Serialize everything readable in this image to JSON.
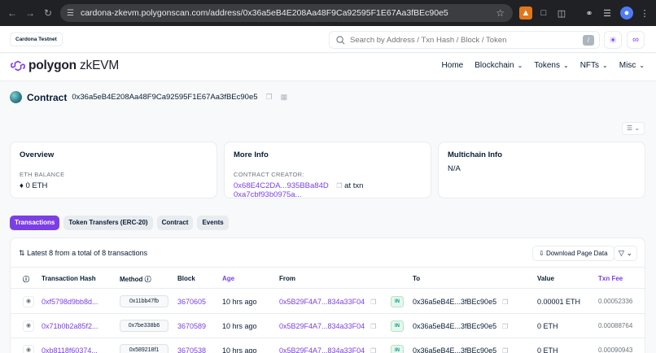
{
  "browser": {
    "url": "cardona-zkevm.polygonscan.com/address/0x36a5eB4E208Aa48F9Ca92595F1E67Aa3fBEc90e5"
  },
  "topbar": {
    "network_badge": "Cardona Testnet",
    "search_placeholder": "Search by Address / Txn Hash / Block / Token",
    "search_shortcut": "/"
  },
  "header": {
    "logo_bold": "polygon",
    "logo_light": " zkEVM",
    "menu": [
      {
        "label": "Home",
        "dropdown": false
      },
      {
        "label": "Blockchain",
        "dropdown": true
      },
      {
        "label": "Tokens",
        "dropdown": true
      },
      {
        "label": "NFTs",
        "dropdown": true
      },
      {
        "label": "Misc",
        "dropdown": true
      }
    ]
  },
  "contract": {
    "label": "Contract",
    "address": "0x36a5eB4E208Aa48F9Ca92595F1E67Aa3fBEc90e5"
  },
  "cards": {
    "overview": {
      "title": "Overview",
      "balance_label": "ETH BALANCE",
      "balance_value": "0 ETH"
    },
    "more_info": {
      "title": "More Info",
      "creator_label": "CONTRACT CREATOR:",
      "creator_addr": "0x68E4C2DA...935BBa84D",
      "at_txn": "at txn",
      "txn_hash": "0xa7cbf93b0975a..."
    },
    "multichain": {
      "title": "Multichain Info",
      "value": "N/A"
    }
  },
  "tabs": [
    {
      "label": "Transactions",
      "active": true
    },
    {
      "label": "Token Transfers (ERC-20)",
      "active": false
    },
    {
      "label": "Contract",
      "active": false
    },
    {
      "label": "Events",
      "active": false
    }
  ],
  "table": {
    "summary": "Latest 8 from a total of 8 transactions",
    "download_label": "Download Page Data",
    "headers": {
      "hash": "Transaction Hash",
      "method": "Method",
      "block": "Block",
      "age": "Age",
      "from": "From",
      "to": "To",
      "value": "Value",
      "fee": "Txn Fee"
    },
    "rows": [
      {
        "hash": "0xf5798d9bb8d...",
        "method": "0x11bb47fb",
        "block": "3670605",
        "age": "10 hrs ago",
        "from": "0x5B29F4A7...834a33F04",
        "dir": "IN",
        "to": "0x36a5eB4E...3fBEc90e5",
        "value": "0.00001 ETH",
        "fee": "0.00052336"
      },
      {
        "hash": "0x71b0b2a85f2...",
        "method": "0x7be338b6",
        "block": "3670589",
        "age": "10 hrs ago",
        "from": "0x5B29F4A7...834a33F04",
        "dir": "IN",
        "to": "0x36a5eB4E...3fBEc90e5",
        "value": "0 ETH",
        "fee": "0.00088764"
      },
      {
        "hash": "0xb8118f60374...",
        "method": "0x589218f1",
        "block": "3670538",
        "age": "10 hrs ago",
        "from": "0x5B29F4A7...834a33F04",
        "dir": "IN",
        "to": "0x36a5eB4E...3fBEc90e5",
        "value": "0 ETH",
        "fee": "0.00090943"
      }
    ]
  }
}
